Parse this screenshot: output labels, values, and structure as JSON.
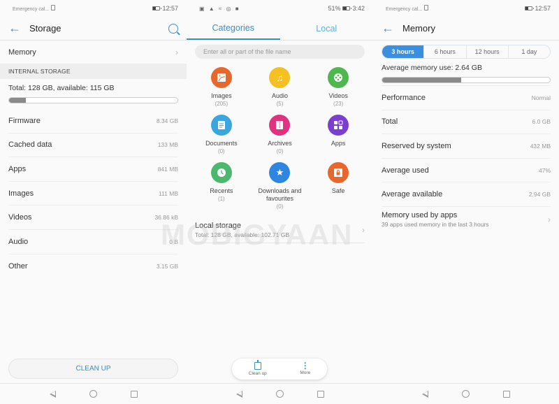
{
  "screen_storage": {
    "status": {
      "left": "Emergency cal...",
      "time": "12:57"
    },
    "title": "Storage",
    "memory_label": "Memory",
    "section_header": "INTERNAL STORAGE",
    "total_text": "Total: 128 GB, available: 115 GB",
    "used_fraction": 0.1,
    "items": [
      {
        "label": "Firmware",
        "value": "8.34 GB"
      },
      {
        "label": "Cached data",
        "value": "133 MB"
      },
      {
        "label": "Apps",
        "value": "841 MB"
      },
      {
        "label": "Images",
        "value": "111 MB"
      },
      {
        "label": "Videos",
        "value": "36.86 kB"
      },
      {
        "label": "Audio",
        "value": "0 B"
      },
      {
        "label": "Other",
        "value": "3.15 GB"
      }
    ],
    "clean_up_label": "CLEAN UP"
  },
  "screen_files": {
    "status": {
      "battery": "51%",
      "time": "3:42"
    },
    "tabs": [
      {
        "label": "Categories"
      },
      {
        "label": "Local"
      }
    ],
    "search_placeholder": "Enter all or part of the file name",
    "categories": [
      {
        "name": "Images",
        "count": "(205)",
        "color": "#e8672c",
        "icon": "image-icon"
      },
      {
        "name": "Audio",
        "count": "(5)",
        "color": "#f5c021",
        "icon": "music-icon"
      },
      {
        "name": "Videos",
        "count": "(23)",
        "color": "#4cb84e",
        "icon": "film-reel-icon"
      },
      {
        "name": "Documents",
        "count": "(0)",
        "color": "#3aa6e0",
        "icon": "document-icon"
      },
      {
        "name": "Archives",
        "count": "(0)",
        "color": "#e0327f",
        "icon": "archive-icon"
      },
      {
        "name": "Apps",
        "count": "",
        "color": "#7b3fcf",
        "icon": "apps-grid-icon"
      },
      {
        "name": "Recents",
        "count": "(1)",
        "color": "#4cb86e",
        "icon": "clock-icon"
      },
      {
        "name": "Downloads and favourites",
        "count": "(0)",
        "color": "#2f86e0",
        "icon": "star-icon"
      },
      {
        "name": "Safe",
        "count": "",
        "color": "#e8672c",
        "icon": "safe-lock-icon"
      }
    ],
    "local_storage": {
      "title": "Local storage",
      "subtitle": "Total: 128 GB, available: 102.71 GB"
    },
    "fab": {
      "clean_up": "Clean up",
      "more": "More"
    },
    "watermark": "MOBIGYAAN"
  },
  "screen_memory": {
    "status": {
      "left": "Emergency cal...",
      "time": "12:57"
    },
    "title": "Memory",
    "ranges": [
      "3 hours",
      "6 hours",
      "12 hours",
      "1 day"
    ],
    "selected_range": "3 hours",
    "avg_text": "Average memory use: 2.64 GB",
    "used_fraction": 0.47,
    "items": [
      {
        "label": "Performance",
        "value": "Normal"
      },
      {
        "label": "Total",
        "value": "6.0 GB"
      },
      {
        "label": "Reserved by system",
        "value": "432 MB"
      },
      {
        "label": "Average used",
        "value": "47%"
      },
      {
        "label": "Average available",
        "value": "2.94 GB"
      }
    ],
    "apps_row": {
      "title": "Memory used by apps",
      "subtitle": "39 apps used memory in the last 3 hours"
    }
  }
}
